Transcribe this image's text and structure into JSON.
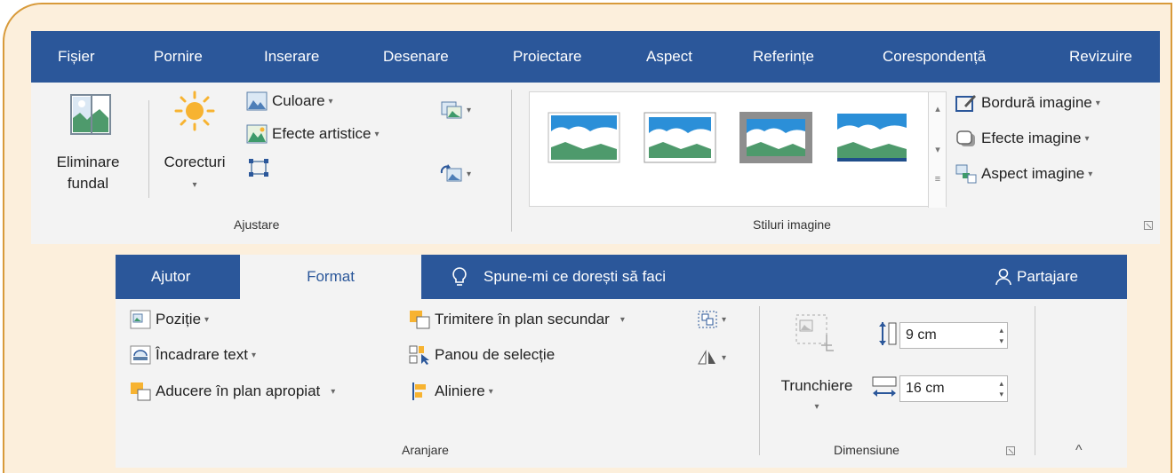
{
  "ribbon_top": {
    "tabs": [
      "Fișier",
      "Pornire",
      "Inserare",
      "Desenare",
      "Proiectare",
      "Aspect",
      "Referințe",
      "Corespondență",
      "Revizuire"
    ],
    "remove_background": {
      "line1": "Eliminare",
      "line2": "fundal"
    },
    "corrections": {
      "label": "Corecturi",
      "caret": "▾"
    },
    "color": "Culoare",
    "artistic_effects": "Efecte artistice",
    "group_adjust": "Ajustare",
    "picture_border": "Bordură imagine",
    "picture_effects": "Efecte imagine",
    "picture_layout": "Aspect imagine",
    "group_styles": "Stiluri imagine",
    "caret": "▾"
  },
  "ribbon_bottom": {
    "tabs": {
      "help": "Ajutor",
      "format": "Format",
      "tell_me": "Spune-mi ce dorești să faci",
      "share": "Partajare"
    },
    "position": "Poziție",
    "wrap_text": "Încadrare text",
    "bring_forward": "Aducere în plan apropiat",
    "send_backward": "Trimitere în plan secundar",
    "selection_pane": "Panou de selecție",
    "align": "Aliniere",
    "group_arrange": "Aranjare",
    "crop": {
      "label": "Trunchiere",
      "caret": "▾"
    },
    "height_value": "9 cm",
    "width_value": "16 cm",
    "group_size": "Dimensiune",
    "collapse": "^",
    "caret": "▾"
  },
  "colors": {
    "ribbon_blue": "#2b579a",
    "ribbon_body": "#f3f3f3",
    "frame_border": "#d89a3a",
    "frame_fill": "#fcefdc"
  },
  "icons": [
    "remove-background-icon",
    "sun-icon",
    "color-icon",
    "artistic-effects-icon",
    "transparency-icon",
    "compress-icon",
    "change-picture-icon",
    "reset-picture-icon",
    "picture-border-icon",
    "picture-effects-icon",
    "picture-layout-icon",
    "lightbulb-icon",
    "person-icon",
    "position-icon",
    "wrap-text-icon",
    "bring-forward-icon",
    "send-backward-icon",
    "selection-pane-icon",
    "align-icon",
    "group-icon",
    "rotate-icon",
    "crop-icon",
    "height-icon",
    "width-icon"
  ]
}
